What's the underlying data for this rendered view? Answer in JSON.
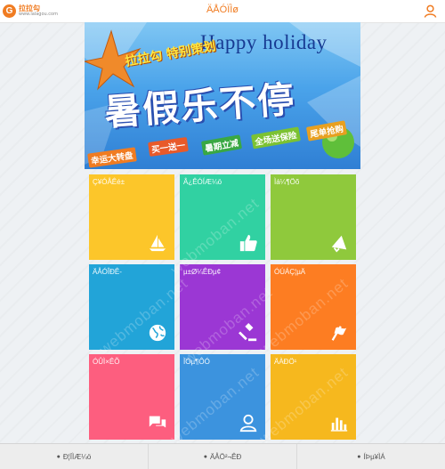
{
  "header": {
    "logo_main": "拉拉勾",
    "logo_sub": "www.lalagou.com",
    "title": "ÄÅÓÏÌø",
    "accent": "#f07c22"
  },
  "banner": {
    "happy": "Happy holiday",
    "sub": "拉拉勾 特别策划",
    "main": "暑假乐不停",
    "tags": [
      "幸运大转盘",
      "买一送一",
      "暑期立减",
      "全场送保险",
      "尾单抢购"
    ]
  },
  "tiles": [
    {
      "label": "Ç¥ÓÅÊé±",
      "icon": "sailboat-icon",
      "color": "#fcc62a"
    },
    {
      "label": "Â¿ÊÓÍÆ¼ö",
      "icon": "thumbs-up-icon",
      "color": "#31d1a2"
    },
    {
      "label": "Ìá¼¶Öõ",
      "icon": "megaphone-icon",
      "color": "#8fc93c"
    },
    {
      "label": "ÄÅÓÎÐÊ-",
      "icon": "globe-icon",
      "color": "#22a4d8"
    },
    {
      "label": "µ±Ø¼ÊÐµ¢",
      "icon": "gavel-icon",
      "color": "#9b37d4"
    },
    {
      "label": "ÓÚÁÇ¦µÄ",
      "icon": "flag-icon",
      "color": "#fd7d22"
    },
    {
      "label": "ÓÛÌ×ÊÕ",
      "icon": "chat-icon",
      "color": "#fd5e7f"
    },
    {
      "label": "ÌÒµ¶ÔÓ",
      "icon": "user-icon",
      "color": "#3c93de"
    },
    {
      "label": "ÄÀÐÖ¹",
      "icon": "bar-chart-icon",
      "color": "#f6b81e"
    }
  ],
  "watermark": "webmoban.net",
  "footer": {
    "items": [
      {
        "label": "Ð¦ÏÌÆ¼ö"
      },
      {
        "label": "ÄÅÖ²¬ÊÐ"
      },
      {
        "label": "ÍÞµ¥ÌÁ"
      }
    ]
  }
}
